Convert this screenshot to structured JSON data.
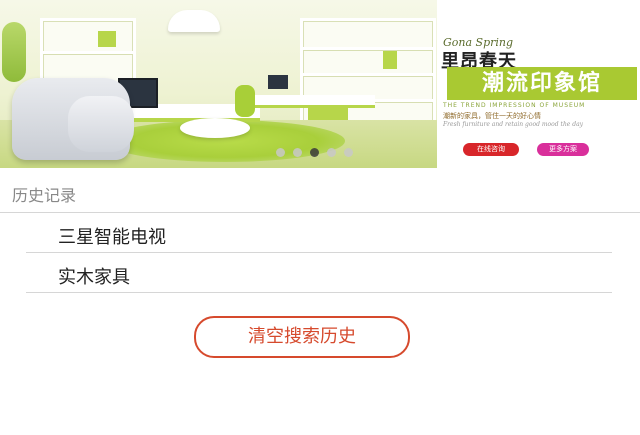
{
  "banner": {
    "promo_script": "Gona Spring",
    "promo_title": "里昂春天",
    "promo_headline": "潮流印象馆",
    "promo_english": "THE TREND IMPRESSION OF MUSEUM",
    "promo_subtitle": "潮新的家具，管住一天的好心情",
    "promo_subtitle_en": "Fresh furniture and retain good mood the day",
    "promo_button_left": "在线咨询",
    "promo_button_right": "更多方案",
    "slide_count": 5,
    "active_slide": 3,
    "accent_color": "#a9c932"
  },
  "history": {
    "title": "历史记录",
    "items": [
      {
        "label": "三星智能电视"
      },
      {
        "label": "实木家具"
      }
    ],
    "clear_button": "清空搜索历史",
    "clear_button_color": "#d64a2d"
  }
}
